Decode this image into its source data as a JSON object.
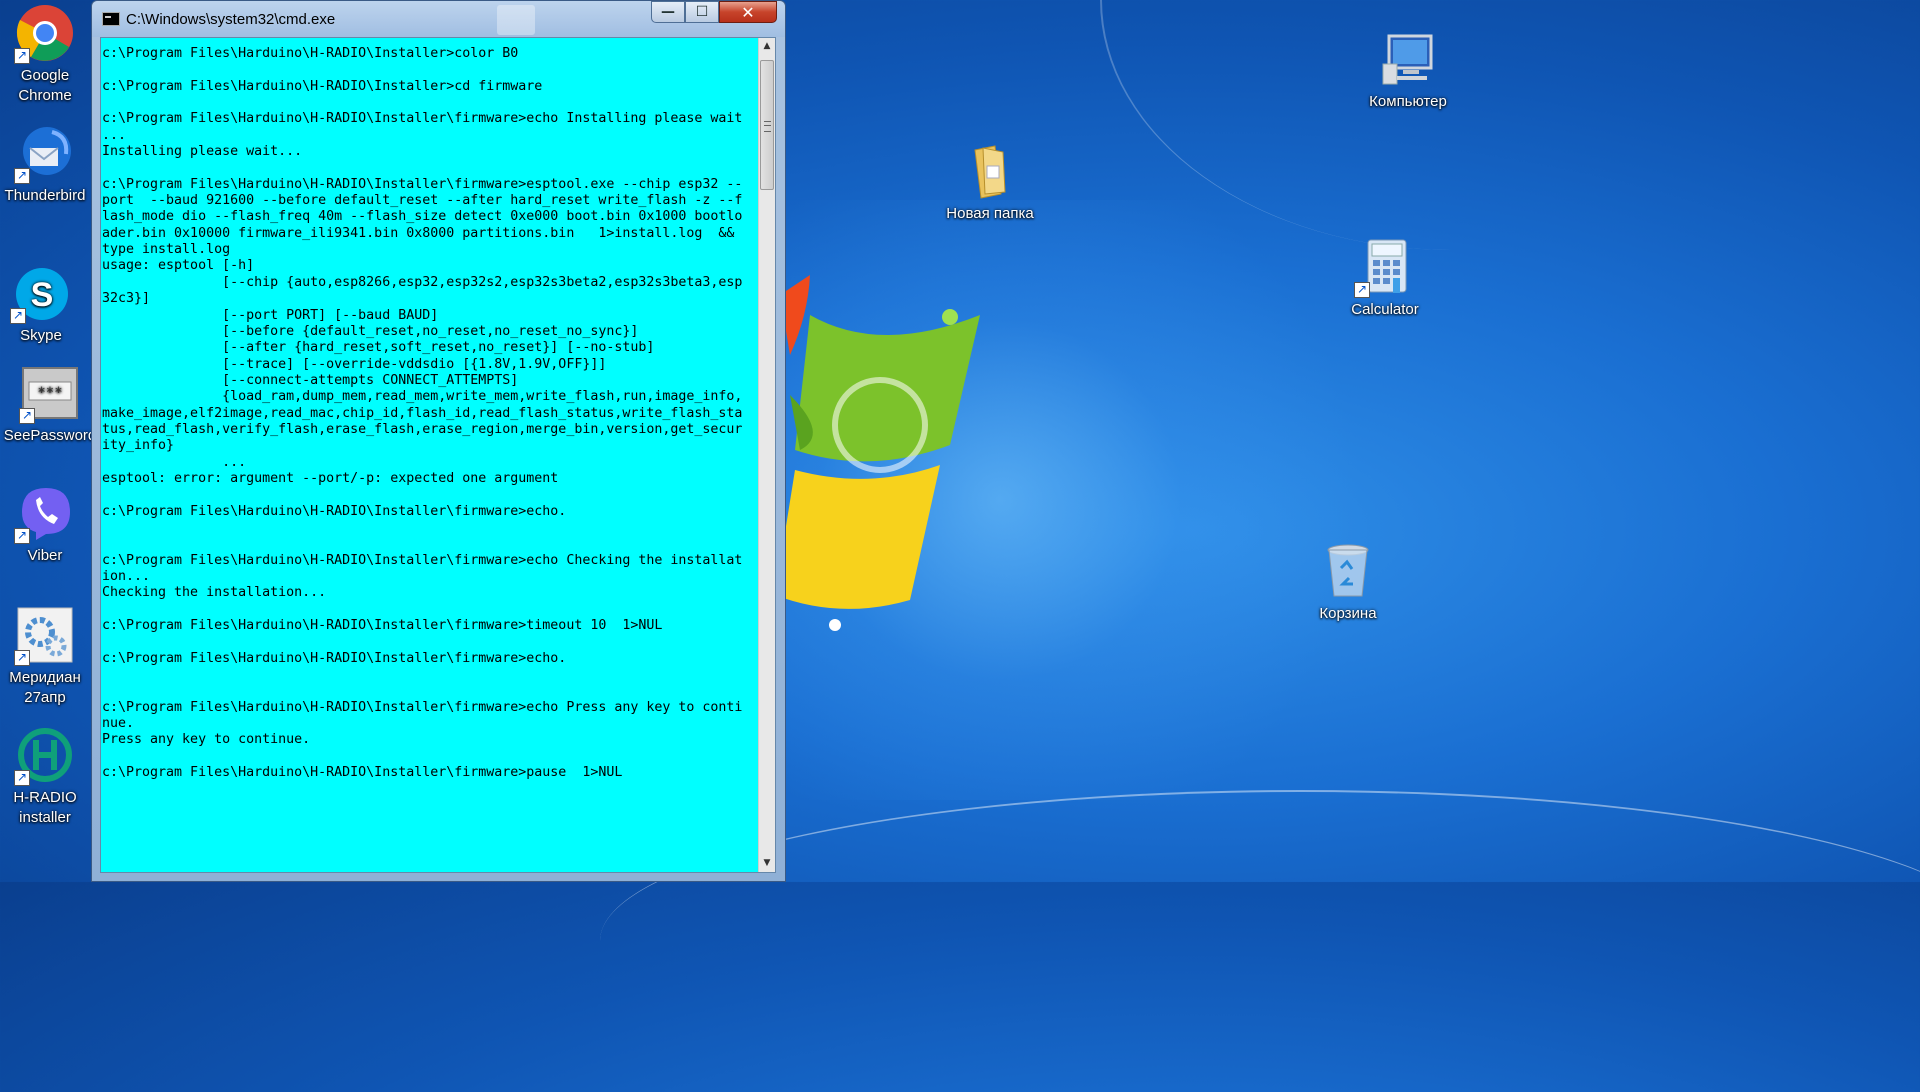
{
  "window": {
    "title": "C:\\Windows\\system32\\cmd.exe",
    "min_glyph": "—",
    "max_glyph": "☐",
    "close_glyph": "✕"
  },
  "console_lines": [
    "c:\\Program Files\\Harduino\\H-RADIO\\Installer>color B0",
    "",
    "c:\\Program Files\\Harduino\\H-RADIO\\Installer>cd firmware",
    "",
    "c:\\Program Files\\Harduino\\H-RADIO\\Installer\\firmware>echo Installing please wait",
    "...",
    "Installing please wait...",
    "",
    "c:\\Program Files\\Harduino\\H-RADIO\\Installer\\firmware>esptool.exe --chip esp32 --",
    "port  --baud 921600 --before default_reset --after hard_reset write_flash -z --f",
    "lash_mode dio --flash_freq 40m --flash_size detect 0xe000 boot.bin 0x1000 bootlo",
    "ader.bin 0x10000 firmware_ili9341.bin 0x8000 partitions.bin   1>install.log  &&",
    "type install.log",
    "usage: esptool [-h]",
    "               [--chip {auto,esp8266,esp32,esp32s2,esp32s3beta2,esp32s3beta3,esp",
    "32c3}]",
    "               [--port PORT] [--baud BAUD]",
    "               [--before {default_reset,no_reset,no_reset_no_sync}]",
    "               [--after {hard_reset,soft_reset,no_reset}] [--no-stub]",
    "               [--trace] [--override-vddsdio [{1.8V,1.9V,OFF}]]",
    "               [--connect-attempts CONNECT_ATTEMPTS]",
    "               {load_ram,dump_mem,read_mem,write_mem,write_flash,run,image_info,",
    "make_image,elf2image,read_mac,chip_id,flash_id,read_flash_status,write_flash_sta",
    "tus,read_flash,verify_flash,erase_flash,erase_region,merge_bin,version,get_secur",
    "ity_info}",
    "               ...",
    "esptool: error: argument --port/-p: expected one argument",
    "",
    "c:\\Program Files\\Harduino\\H-RADIO\\Installer\\firmware>echo.",
    "",
    "",
    "c:\\Program Files\\Harduino\\H-RADIO\\Installer\\firmware>echo Checking the installat",
    "ion...",
    "Checking the installation...",
    "",
    "c:\\Program Files\\Harduino\\H-RADIO\\Installer\\firmware>timeout 10  1>NUL",
    "",
    "c:\\Program Files\\Harduino\\H-RADIO\\Installer\\firmware>echo.",
    "",
    "",
    "c:\\Program Files\\Harduino\\H-RADIO\\Installer\\firmware>echo Press any key to conti",
    "nue.",
    "Press any key to continue.",
    "",
    "c:\\Program Files\\Harduino\\H-RADIO\\Installer\\firmware>pause  1>NUL"
  ],
  "desktop_icons_left": [
    {
      "label": "Google Chrome",
      "icon": "chrome-icon"
    },
    {
      "label": "Thunderbird",
      "icon": "thunderbird-icon"
    },
    {
      "label": "Skype",
      "icon": "skype-icon"
    },
    {
      "label": "SeePassword",
      "icon": "seepassword-icon"
    },
    {
      "label": "Viber",
      "icon": "viber-icon"
    },
    {
      "label": "Меридиан 27апр",
      "icon": "meridian-icon"
    },
    {
      "label": "H-RADIO installer",
      "icon": "h-radio-icon"
    }
  ],
  "desktop_icons_right": [
    {
      "label": "Компьютер",
      "icon": "computer-icon"
    },
    {
      "label": "Новая папка",
      "icon": "folder-icon"
    },
    {
      "label": "Calculator",
      "icon": "calculator-icon"
    },
    {
      "label": "Корзина",
      "icon": "recycle-bin-icon"
    }
  ],
  "colors": {
    "console_bg": "#00ffff",
    "console_fg": "#000000",
    "desktop": "#1a6fd2"
  }
}
